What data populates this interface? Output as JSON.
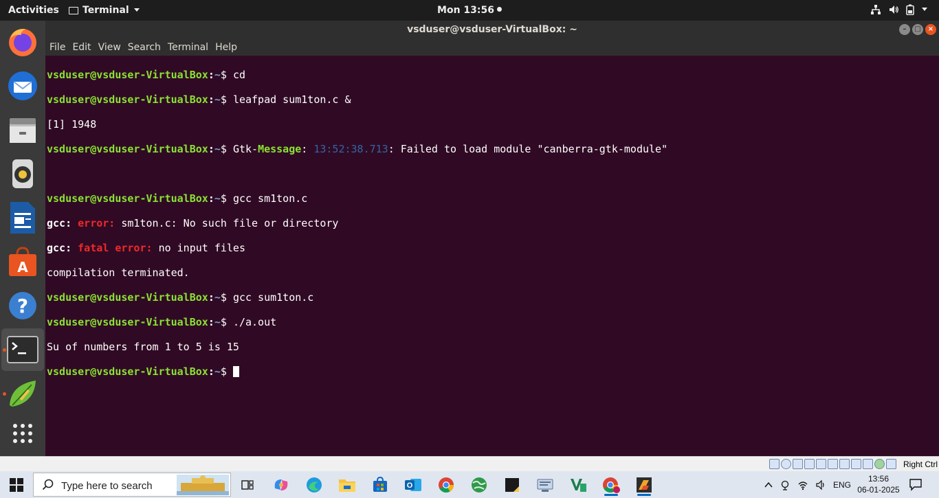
{
  "topbar": {
    "activities": "Activities",
    "app_name": "Terminal",
    "clock": "Mon 13:56"
  },
  "window": {
    "title": "vsduser@vsduser-VirtualBox: ~",
    "menu": [
      "File",
      "Edit",
      "View",
      "Search",
      "Terminal",
      "Help"
    ]
  },
  "terminal": {
    "prompt_user": "vsduser@vsduser-VirtualBox",
    "prompt_path": "~",
    "prompt_sigil": "$",
    "lines": {
      "cmd_cd": "cd",
      "cmd_leafpad": "leafpad sum1ton.c &",
      "job": "[1] 1948",
      "gtk_prefix": "Gtk-",
      "gtk_word": "Message",
      "gtk_sep": ": ",
      "gtk_time": "13:52:38.713",
      "gtk_msg": ": Failed to load module \"canberra-gtk-module\"",
      "cmd_gcc1": "gcc sm1ton.c",
      "gcc_label": "gcc:",
      "err_label": "error:",
      "err_msg": "sm1ton.c: No such file or directory",
      "fatal_label": "fatal error:",
      "fatal_msg": "no input files",
      "terminated": "compilation terminated.",
      "cmd_gcc2": "gcc sum1ton.c",
      "cmd_run": "./a.out",
      "output": "Su of numbers from 1 to 5 is 15"
    }
  },
  "vbox": {
    "host_key": "Right Ctrl"
  },
  "taskbar": {
    "search_placeholder": "Type here to search",
    "lang": "ENG",
    "time": "13:56",
    "date": "06-01-2025"
  },
  "colors": {
    "terminal_bg": "#300a24",
    "prompt_user": "#8ae234",
    "prompt_path": "#729fcf",
    "error": "#ef2929",
    "accent": "#e95420"
  },
  "icons": {
    "dock": [
      "firefox-icon",
      "thunderbird-icon",
      "files-icon",
      "rhythmbox-icon",
      "writer-icon",
      "software-icon",
      "help-icon",
      "terminal-icon",
      "leafpad-icon",
      "app-grid-icon"
    ],
    "taskbar": [
      "task-view-icon",
      "copilot-icon",
      "edge-icon",
      "file-explorer-icon",
      "store-icon",
      "outlook-icon",
      "chrome-icon",
      "globe-icon",
      "sticky-notes-icon",
      "network-app-icon",
      "vs-icon",
      "chrome-profile-icon",
      "virtualbox-icon"
    ]
  }
}
